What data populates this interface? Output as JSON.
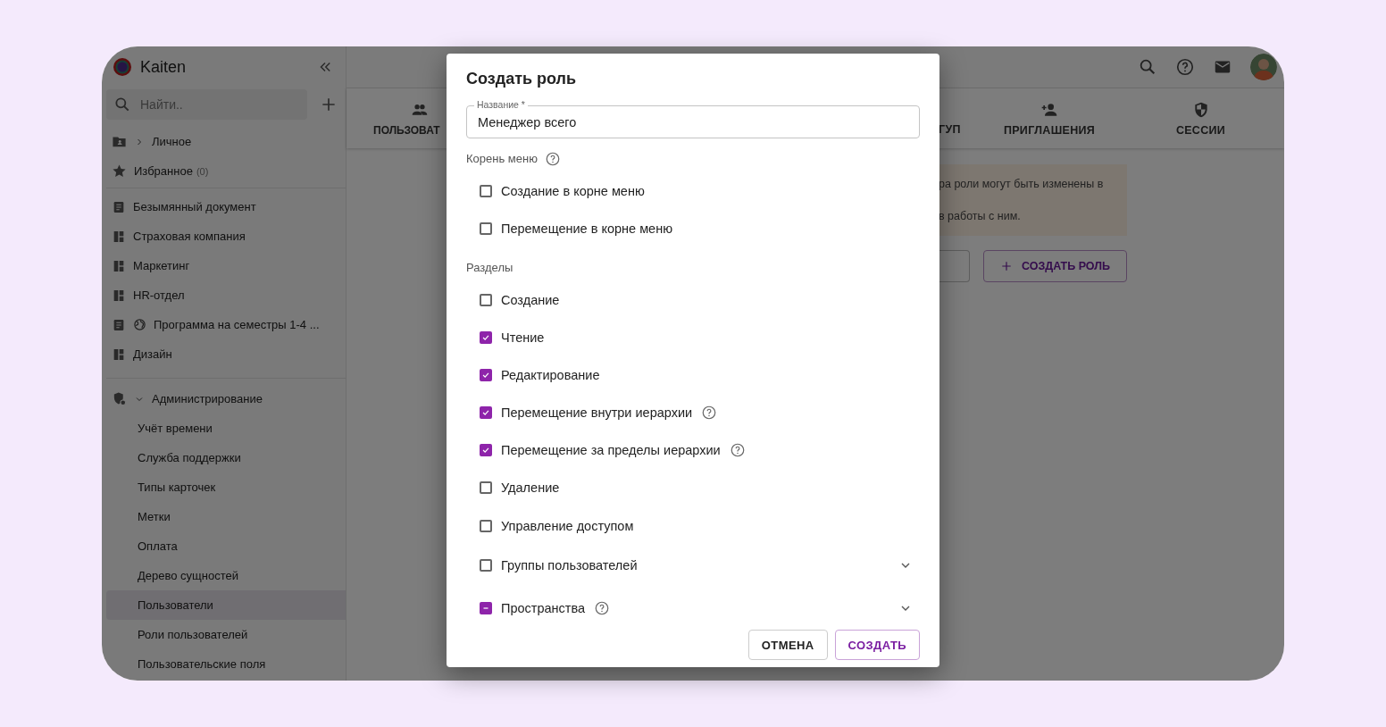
{
  "app": {
    "logo": "Kaiten"
  },
  "sidebar": {
    "search": {
      "placeholder": "Найти.."
    },
    "personal": {
      "label": "Личное",
      "expanded": false
    },
    "favorites": {
      "label": "Избранное",
      "count": "(0)"
    },
    "spaces": [
      {
        "label": "Безымянный документ",
        "kind": "document",
        "shared": false
      },
      {
        "label": "Страховая компания",
        "kind": "board",
        "shared": false
      },
      {
        "label": "Маркетинг",
        "kind": "board",
        "shared": false
      },
      {
        "label": "HR-отдел",
        "kind": "board",
        "shared": false
      },
      {
        "label": "Программа на семестры 1-4 ...",
        "kind": "document",
        "shared": true
      },
      {
        "label": "Дизайн",
        "kind": "board",
        "shared": false
      }
    ],
    "admin": {
      "label": "Администрирование",
      "expanded": true,
      "children": [
        {
          "label": "Учёт времени",
          "selected": false
        },
        {
          "label": "Служба поддержки",
          "selected": false
        },
        {
          "label": "Типы карточек",
          "selected": false
        },
        {
          "label": "Метки",
          "selected": false
        },
        {
          "label": "Оплата",
          "selected": false
        },
        {
          "label": "Дерево сущностей",
          "selected": false
        },
        {
          "label": "Пользователи",
          "selected": true
        },
        {
          "label": "Роли пользователей",
          "selected": false
        },
        {
          "label": "Пользовательские поля",
          "selected": false
        }
      ]
    }
  },
  "tabs": [
    {
      "label": "ПОЛЬЗОВАТ",
      "kind": "users"
    },
    {
      "label": "ГУП",
      "kind": "partial"
    },
    {
      "label": "ПРИГЛАШЕНИЯ",
      "kind": "invite"
    },
    {
      "label": "СЕССИИ",
      "kind": "sessions"
    }
  ],
  "notice": {
    "lines": [
      "ра роли могут быть изменены в",
      "в работы с ним."
    ]
  },
  "actions": {
    "create_role": "СОЗДАТЬ РОЛЬ"
  },
  "dialog": {
    "title": "Создать роль",
    "name_field": {
      "label": "Название *",
      "value": "Менеджер всего"
    },
    "sections": [
      {
        "title": "Корень меню",
        "help": true,
        "items": [
          {
            "label": "Создание в корне меню",
            "kind": "checkbox",
            "checked": false,
            "indeterminate": false,
            "help": false
          },
          {
            "label": "Перемещение в корне меню",
            "kind": "checkbox",
            "checked": false,
            "indeterminate": false,
            "help": false
          }
        ]
      },
      {
        "title": "Разделы",
        "help": false,
        "items": [
          {
            "label": "Создание",
            "kind": "checkbox",
            "checked": false,
            "indeterminate": false,
            "help": false
          },
          {
            "label": "Чтение",
            "kind": "checkbox",
            "checked": true,
            "indeterminate": false,
            "help": false
          },
          {
            "label": "Редактирование",
            "kind": "checkbox",
            "checked": true,
            "indeterminate": false,
            "help": false
          },
          {
            "label": "Перемещение внутри иерархии",
            "kind": "checkbox",
            "checked": true,
            "indeterminate": false,
            "help": true
          },
          {
            "label": "Перемещение за пределы иерархии",
            "kind": "checkbox",
            "checked": true,
            "indeterminate": false,
            "help": true
          },
          {
            "label": "Удаление",
            "kind": "checkbox",
            "checked": false,
            "indeterminate": false,
            "help": false
          },
          {
            "label": "Управление доступом",
            "kind": "checkbox",
            "checked": false,
            "indeterminate": false,
            "help": false
          },
          {
            "label": "Группы пользователей",
            "kind": "group",
            "checked": false,
            "indeterminate": false,
            "help": false,
            "expanded": false
          },
          {
            "label": "Пространства",
            "kind": "group",
            "checked": true,
            "indeterminate": true,
            "help": true,
            "expanded": false
          }
        ]
      }
    ],
    "buttons": {
      "cancel": "ОТМЕНА",
      "create": "СОЗДАТЬ"
    }
  }
}
